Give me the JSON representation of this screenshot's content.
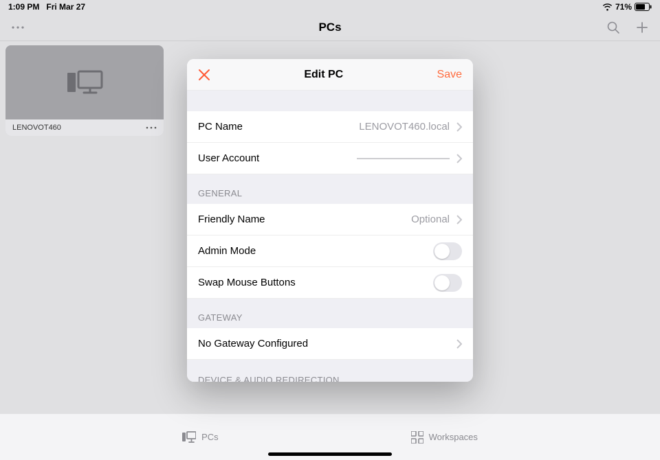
{
  "status": {
    "time": "1:09 PM",
    "date": "Fri Mar 27",
    "battery": "71%"
  },
  "nav": {
    "title": "PCs"
  },
  "pc_card": {
    "name": "LENOVOT460"
  },
  "tabs": {
    "pcs": "PCs",
    "workspaces": "Workspaces"
  },
  "modal": {
    "title": "Edit PC",
    "save_label": "Save",
    "rows": {
      "pc_name": {
        "label": "PC Name",
        "value": "LENOVOT460.local"
      },
      "user_account": {
        "label": "User Account",
        "value": "—————————"
      }
    },
    "sections": {
      "general": "General",
      "gateway": "Gateway",
      "redirection": "Device & Audio Redirection"
    },
    "general_rows": {
      "friendly_name": {
        "label": "Friendly Name",
        "placeholder": "Optional"
      },
      "admin_mode": {
        "label": "Admin Mode",
        "on": false
      },
      "swap_mouse": {
        "label": "Swap Mouse Buttons",
        "on": false
      }
    },
    "gateway_rows": {
      "none": {
        "label": "No Gateway Configured"
      }
    }
  }
}
